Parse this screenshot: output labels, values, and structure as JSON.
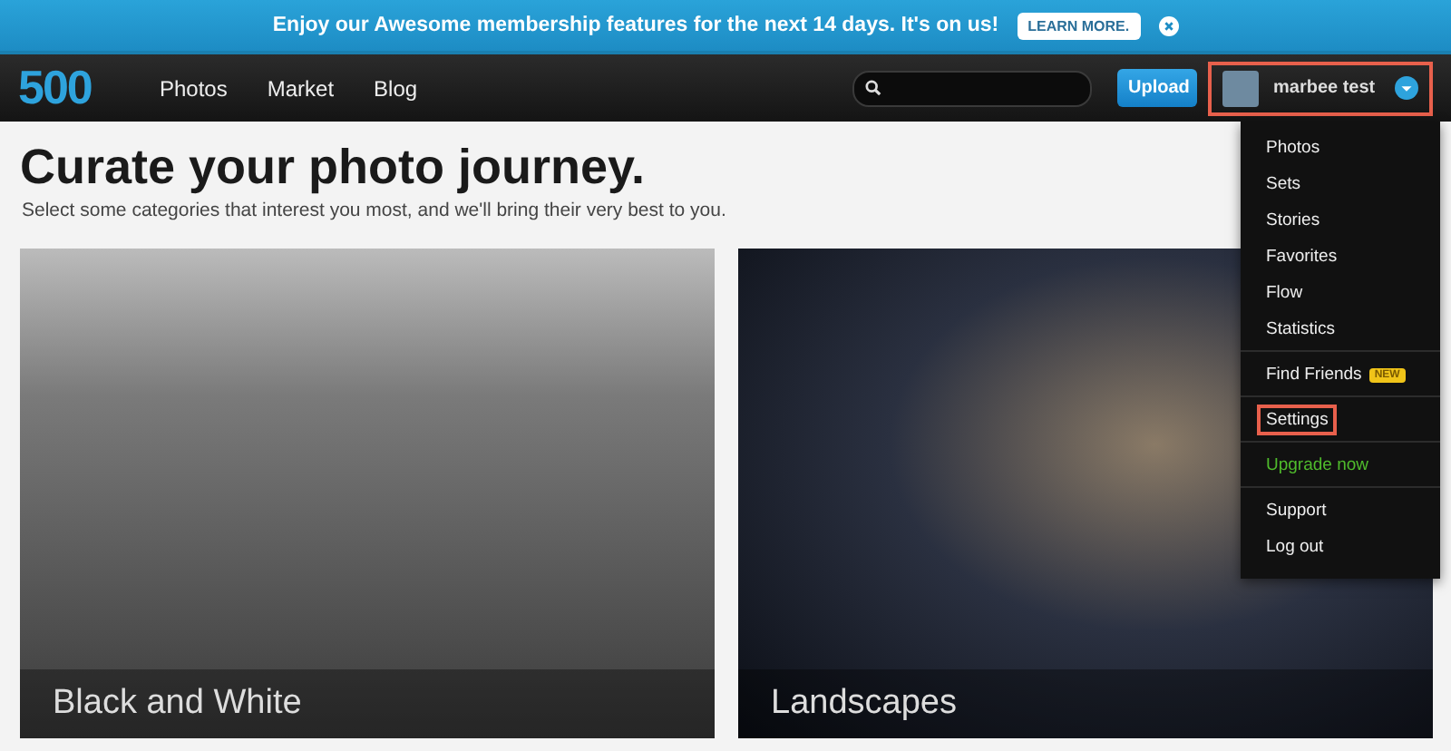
{
  "banner": {
    "text": "Enjoy our Awesome membership features for the next 14 days. It's on us!",
    "button": "LEARN MORE."
  },
  "nav": {
    "logo": "500",
    "links": [
      "Photos",
      "Market",
      "Blog"
    ],
    "upload": "Upload",
    "user": {
      "name": "marbee test",
      "highlighted": true
    }
  },
  "menu": {
    "groups": [
      [
        {
          "label": "Photos",
          "kind": "normal",
          "highlighted": false
        },
        {
          "label": "Sets",
          "kind": "normal",
          "highlighted": false
        },
        {
          "label": "Stories",
          "kind": "normal",
          "highlighted": false
        },
        {
          "label": "Favorites",
          "kind": "normal",
          "highlighted": false
        },
        {
          "label": "Flow",
          "kind": "normal",
          "highlighted": false
        },
        {
          "label": "Statistics",
          "kind": "normal",
          "highlighted": false
        }
      ],
      [
        {
          "label": "Find Friends",
          "kind": "normal",
          "badge": "NEW",
          "highlighted": false
        }
      ],
      [
        {
          "label": "Settings",
          "kind": "normal",
          "highlighted": true
        }
      ],
      [
        {
          "label": "Upgrade now",
          "kind": "upgrade",
          "highlighted": false
        }
      ],
      [
        {
          "label": "Support",
          "kind": "normal",
          "highlighted": false
        },
        {
          "label": "Log out",
          "kind": "normal",
          "highlighted": false
        }
      ]
    ]
  },
  "heading": "Curate your photo journey.",
  "subheading": "Select some categories that interest you most, and we'll bring their very best to you.",
  "categories": [
    {
      "label": "Black and White",
      "kind": "mono"
    },
    {
      "label": "Landscapes",
      "kind": "night"
    }
  ]
}
